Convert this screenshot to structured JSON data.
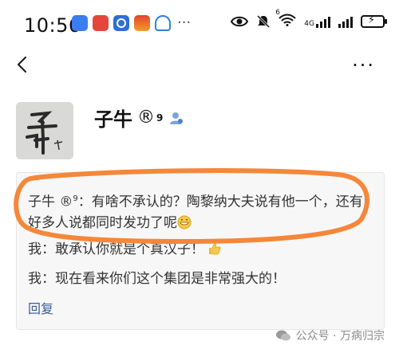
{
  "status_bar": {
    "time": "10:56",
    "more": "···",
    "network_label": "4G",
    "wifi_label": "6"
  },
  "profile": {
    "name": "子牛",
    "reg_mark": "®",
    "superscript": "9"
  },
  "comment": {
    "quoted_author": "子牛",
    "quoted_mark": "®",
    "quoted_sup": "9",
    "quoted_text": "：有啥不承认的？陶黎纳大夫说有他一个，还有好多人说都同时发功了呢",
    "reply_1": "我：敢承认你就是个真汉子！",
    "reply_2": "我：现在看来你们这个集团是非常强大的！",
    "reply_link": "回复"
  },
  "watermark": {
    "text": "公众号 · 万病归宗"
  },
  "colors": {
    "highlight": "#f5873a",
    "link": "#3a5b9a",
    "card_bg": "#f7f7f7"
  }
}
